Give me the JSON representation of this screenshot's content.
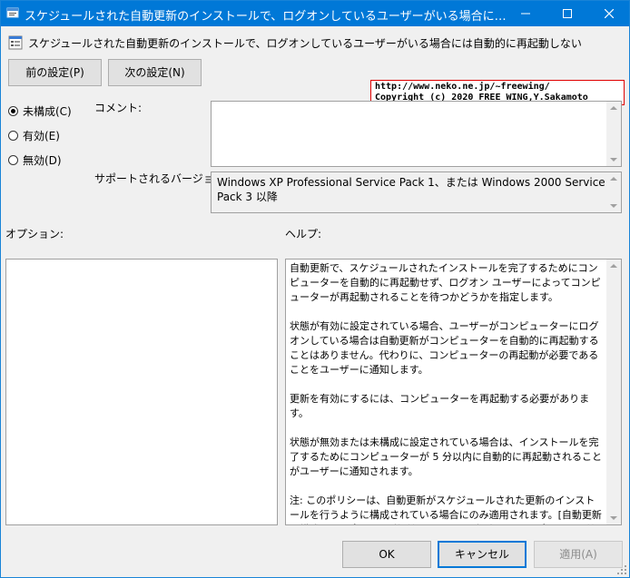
{
  "window": {
    "title": "スケジュールされた自動更新のインストールで、ログオンしているユーザーがいる場合には自動的..."
  },
  "policy": {
    "name": "スケジュールされた自動更新のインストールで、ログオンしているユーザーがいる場合には自動的に再起動しない"
  },
  "nav": {
    "prev": "前の設定(P)",
    "next": "次の設定(N)"
  },
  "state": {
    "options": [
      {
        "label": "未構成(C)",
        "checked": true
      },
      {
        "label": "有効(E)",
        "checked": false
      },
      {
        "label": "無効(D)",
        "checked": false
      }
    ]
  },
  "comment": {
    "label": "コメント:",
    "value": ""
  },
  "supported": {
    "label": "サポートされるバージョン:",
    "value": "Windows XP Professional Service Pack 1、または Windows 2000 Service Pack 3 以降"
  },
  "copyright": {
    "line1": "http://www.neko.ne.jp/~freewing/",
    "line2": "Copyright (c) 2020 FREE WING,Y.Sakamoto"
  },
  "options_label": "オプション:",
  "help_label": "ヘルプ:",
  "help": [
    "自動更新で、スケジュールされたインストールを完了するためにコンピューターを自動的に再起動せず、ログオン ユーザーによってコンピューターが再起動されることを待つかどうかを指定します。",
    "状態が有効に設定されている場合、ユーザーがコンピューターにログオンしている場合は自動更新がコンピューターを自動的に再起動することはありません。代わりに、コンピューターの再起動が必要であることをユーザーに通知します。",
    "更新を有効にするには、コンピューターを再起動する必要があります。",
    "状態が無効または未構成に設定されている場合は、インストールを完了するためにコンピューターが 5 分以内に自動的に再起動されることがユーザーに通知されます。",
    "注: このポリシーは、自動更新がスケジュールされた更新のインストールを行うように構成されている場合にのみ適用されます。[自動更新を構成する] ポリシーが無効になっている場合は、このポリシーは効果はありません。"
  ],
  "buttons": {
    "ok": "OK",
    "cancel": "キャンセル",
    "apply": "適用(A)"
  },
  "colors": {
    "titlebar": "#0078d7",
    "accent": "#0078d7"
  }
}
